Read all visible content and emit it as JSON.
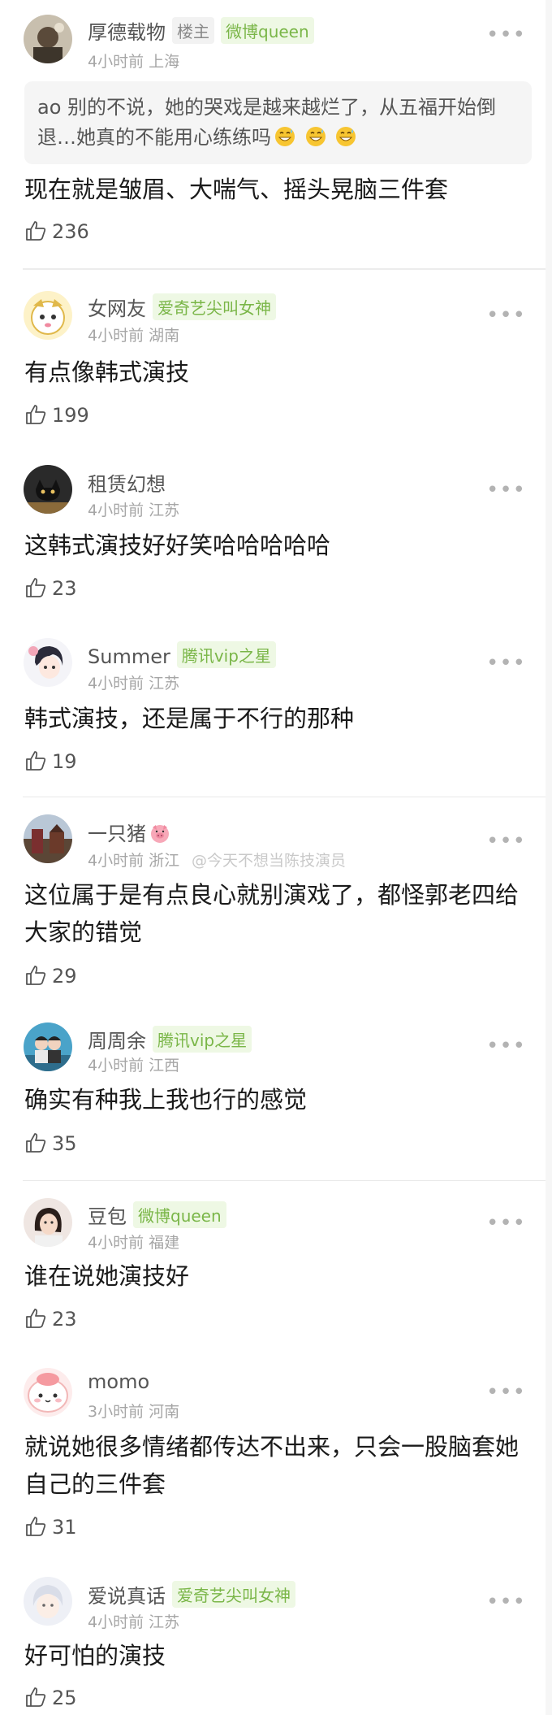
{
  "comments": [
    {
      "username": "厚德载物",
      "owner_badge": "楼主",
      "badge": "微博queen",
      "time": "4小时前",
      "location": "上海",
      "quote": "ao 别的不说，她的哭戏是越来越烂了，从五福开始倒退…她真的不能用心练练吗",
      "quote_emoji_count": 3,
      "text": "现在就是皱眉、大喘气、摇头晃脑三件套",
      "likes": "236"
    },
    {
      "username": "女网友",
      "badge": "爱奇艺尖叫女神",
      "time": "4小时前",
      "location": "湖南",
      "text": "有点像韩式演技",
      "likes": "199"
    },
    {
      "username": "租赁幻想",
      "time": "4小时前",
      "location": "江苏",
      "text": "这韩式演技好好笑哈哈哈哈哈",
      "likes": "23"
    },
    {
      "username": "Summer",
      "badge": "腾讯vip之星",
      "time": "4小时前",
      "location": "江苏",
      "text": "韩式演技，还是属于不行的那种",
      "likes": "19"
    },
    {
      "username": "一只猪",
      "time": "4小时前",
      "location": "浙江",
      "text": "这位属于是有点良心就别演戏了，都怪郭老四给大家的错觉",
      "likes": "29"
    },
    {
      "username": "周周余",
      "badge": "腾讯vip之星",
      "time": "4小时前",
      "location": "江西",
      "text": "确实有种我上我也行的感觉",
      "likes": "35"
    },
    {
      "username": "豆包",
      "badge": "微博queen",
      "time": "4小时前",
      "location": "福建",
      "text": "谁在说她演技好",
      "likes": "23"
    },
    {
      "username": "momo",
      "time": "3小时前",
      "location": "河南",
      "text": "就说她很多情绪都传达不出来，只会一股脑套她自己的三件套",
      "likes": "31"
    },
    {
      "username": "爱说真话",
      "badge": "爱奇艺尖叫女神",
      "time": "4小时前",
      "location": "江苏",
      "text": "好可怕的演技",
      "likes": "25"
    }
  ],
  "watermark": "@今天不想当陈技演员",
  "icons": {
    "like": "thumbs-up-icon",
    "more": "more-dots-icon",
    "pig": "pig-emoji-icon",
    "grin": "grinning-sweat-emoji-icon"
  },
  "colors": {
    "badge_green": "#7ab648",
    "badge_bg": "#eef8e4",
    "meta_gray": "#a6a6a6"
  }
}
